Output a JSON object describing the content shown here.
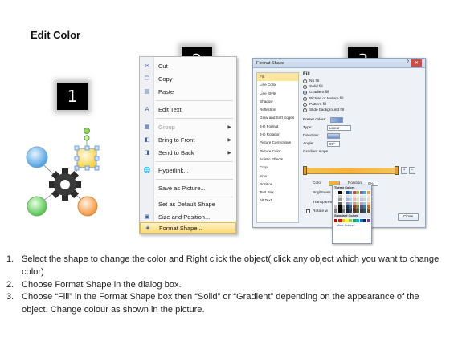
{
  "title": "Edit Color",
  "steps": {
    "one": "1",
    "two": "2",
    "three": "3"
  },
  "context_menu": {
    "items": [
      {
        "label": "Cut",
        "icon": "scissors-icon",
        "glyph": "✂"
      },
      {
        "label": "Copy",
        "icon": "copy-icon",
        "glyph": "❐"
      },
      {
        "label": "Paste",
        "icon": "paste-icon",
        "glyph": "▤"
      },
      {
        "label": "Edit Text",
        "icon": "edit-text-icon",
        "glyph": "A"
      },
      {
        "label": "Group",
        "icon": "group-icon",
        "glyph": "▦"
      },
      {
        "label": "Bring to Front",
        "icon": "bring-front-icon",
        "glyph": "◧"
      },
      {
        "label": "Send to Back",
        "icon": "send-back-icon",
        "glyph": "◨"
      },
      {
        "label": "Hyperlink...",
        "icon": "hyperlink-icon",
        "glyph": "🌐"
      },
      {
        "label": "Save as Picture...",
        "icon": "",
        "glyph": ""
      },
      {
        "label": "Set as Default Shape",
        "icon": "",
        "glyph": ""
      },
      {
        "label": "Size and Position...",
        "icon": "size-position-icon",
        "glyph": "▣"
      },
      {
        "label": "Format Shape...",
        "icon": "format-shape-icon",
        "glyph": "◈"
      }
    ]
  },
  "format_dialog": {
    "title": "Format Shape",
    "close": "✕",
    "help": "?",
    "categories": [
      "Fill",
      "Line Color",
      "Line Style",
      "Shadow",
      "Reflection",
      "Glow and Soft Edges",
      "3-D Format",
      "3-D Rotation",
      "Picture Corrections",
      "Picture Color",
      "Artistic Effects",
      "Crop",
      "Size",
      "Position",
      "Text Box",
      "Alt Text"
    ],
    "fill_heading": "Fill",
    "fill_options": [
      "No fill",
      "Solid fill",
      "Gradient fill",
      "Picture or texture fill",
      "Pattern fill",
      "Slide background fill"
    ],
    "selected_fill": "Gradient fill",
    "preset_label": "Preset colors:",
    "type_label": "Type:",
    "type_value": "Linear",
    "direction_label": "Direction:",
    "angle_label": "Angle:",
    "angle_value": "90°",
    "stops_label": "Gradient stops",
    "color_label": "Color",
    "position_label": "Position:",
    "position_value": "0%",
    "brightness_label": "Brightness",
    "transparency_label": "Transparency",
    "rotate_label": "Rotate w",
    "close_button": "Close",
    "palette_theme": "Theme Colors",
    "palette_standard": "Standard Colors",
    "palette_more": "More Colors..."
  },
  "colors": {
    "theme_row": [
      "#ffffff",
      "#000000",
      "#eeece1",
      "#1f497d",
      "#4f81bd",
      "#c0504d",
      "#9bbb59",
      "#8064a2",
      "#4bacc6",
      "#f79646"
    ],
    "standard_row": [
      "#c00000",
      "#ff0000",
      "#ffc000",
      "#ffff00",
      "#92d050",
      "#00b050",
      "#00b0f0",
      "#0070c0",
      "#002060",
      "#7030a0"
    ]
  },
  "instructions": [
    {
      "num": "1.",
      "text": "Select the shape to change the color and Right click the object( click any object which you want to change color)"
    },
    {
      "num": "2.",
      "text": "Choose Format Shape in the dialog box."
    },
    {
      "num": "3.",
      "text": "Choose “Fill” in the Format Shape box then “Solid” or “Gradient” depending on the appearance of the object. Change colour as shown in the picture."
    }
  ]
}
